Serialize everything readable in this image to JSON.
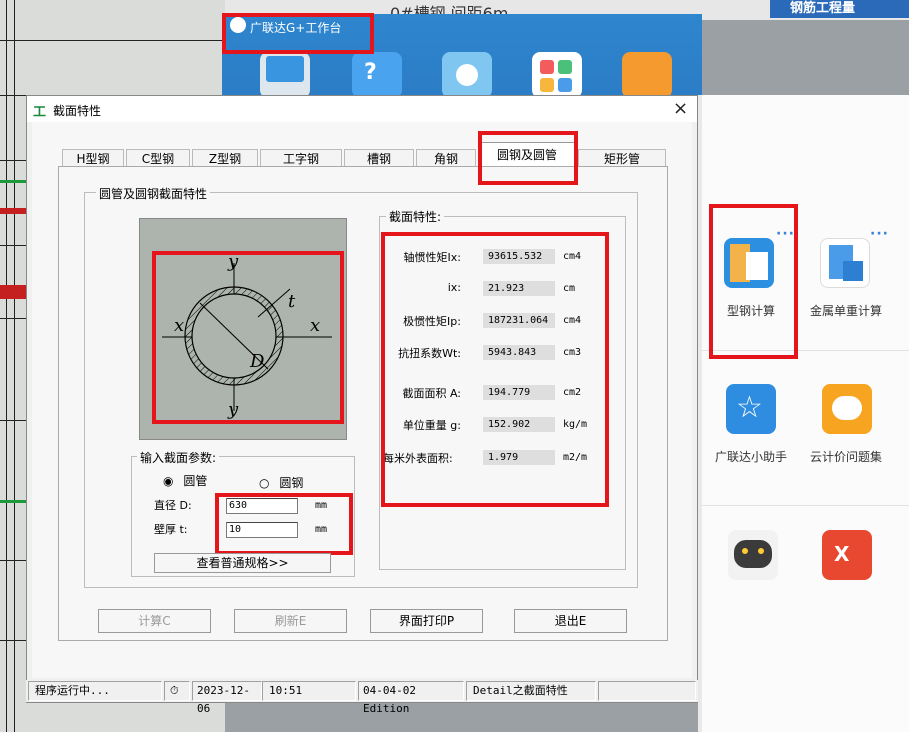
{
  "background": {
    "top_text": "0#槽钢  间距6m",
    "top_right_text": "钢筋工程量"
  },
  "gplus": {
    "title": "广联达G+工作台"
  },
  "apps": [
    {
      "label": "型钢计算"
    },
    {
      "label": "金属单重计算"
    },
    {
      "label": "广联达小助手"
    },
    {
      "label": "云计价问题集"
    }
  ],
  "dialog": {
    "title": "截面特性",
    "close": "×",
    "tabs": [
      "H型钢",
      "C型钢",
      "Z型钢",
      "工字钢",
      "槽钢",
      "角钢",
      "圆钢及圆管",
      "矩形管"
    ],
    "active_tab": "圆钢及圆管",
    "group_main": "圆管及圆钢截面特性",
    "diagram_labels": {
      "y_top": "y",
      "y_bottom": "y",
      "x_left": "x",
      "x_right": "x",
      "t": "t",
      "D": "D"
    },
    "props_title": "截面特性:",
    "props": [
      {
        "label": "轴惯性矩Ix:",
        "value": "93615.532",
        "unit": "cm4"
      },
      {
        "label": "ix:",
        "value": "21.923",
        "unit": "cm"
      },
      {
        "label": "极惯性矩Ip:",
        "value": "187231.064",
        "unit": "cm4"
      },
      {
        "label": "抗扭系数Wt:",
        "value": "5943.843",
        "unit": "cm3"
      },
      {
        "label": "截面面积 A:",
        "value": "194.779",
        "unit": "cm2"
      },
      {
        "label": "单位重量 g:",
        "value": "152.902",
        "unit": "kg/m"
      },
      {
        "label": "每米外表面积:",
        "value": "1.979",
        "unit": "m2/m"
      }
    ],
    "input_title": "输入截面参数:",
    "radio_pipe": "圆管",
    "radio_bar": "圆钢",
    "selected_radio": "圆管",
    "diameter_label": "直径 D:",
    "diameter_value": "630",
    "diameter_unit": "mm",
    "thickness_label": "壁厚 t:",
    "thickness_value": "10",
    "thickness_unit": "mm",
    "spec_button": "查看普通规格>>",
    "buttons": {
      "calc": "计算C",
      "refresh": "刷新E",
      "print": "界面打印P",
      "exit": "退出E"
    }
  },
  "status": {
    "running": "程序运行中...",
    "date": "2023-12-06",
    "time": "10:51",
    "edition": "04-04-02 Edition",
    "detail": "Detail之截面特性"
  },
  "colors": {
    "highlight": "#e5161b",
    "gplus_blue": "#2b7cc4"
  }
}
